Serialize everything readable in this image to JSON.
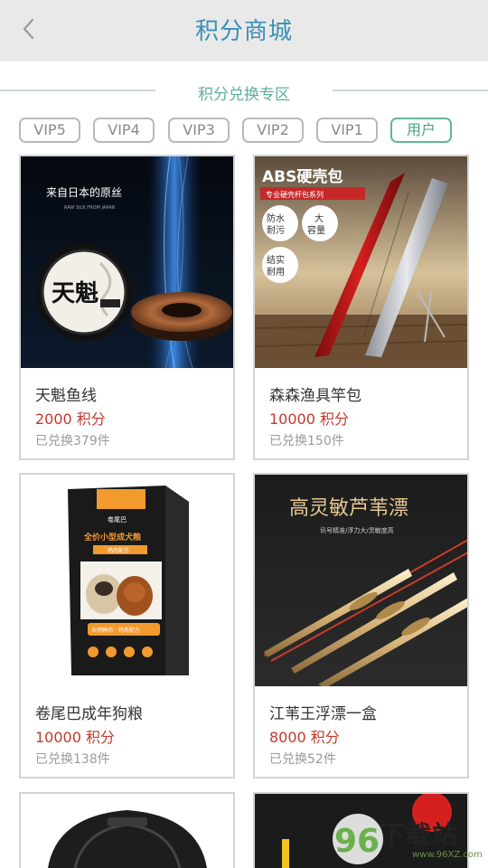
{
  "header": {
    "title": "积分商城",
    "back_icon": "chevron-left-icon"
  },
  "section": {
    "title": "积分兑换专区"
  },
  "tabs": [
    {
      "label": "VIP5",
      "active": false
    },
    {
      "label": "VIP4",
      "active": false
    },
    {
      "label": "VIP3",
      "active": false
    },
    {
      "label": "VIP2",
      "active": false
    },
    {
      "label": "VIP1",
      "active": false
    },
    {
      "label": "用户",
      "active": true
    }
  ],
  "products": [
    {
      "name": "天魁鱼线",
      "price": "2000 积分",
      "sold": "已兑换379件",
      "image": {
        "headline": "来自日本的原丝",
        "subline": "RAW SILK FROM JAPAN",
        "spool_label": "天魁"
      }
    },
    {
      "name": "森森渔具竿包",
      "price": "10000 积分",
      "sold": "已兑换150件",
      "image": {
        "headline": "ABS硬壳包",
        "banner": "专业硬壳杆包系列",
        "badges": [
          "防水耐污",
          "大容量",
          "结实耐用"
        ]
      }
    },
    {
      "name": "卷尾巴成年狗粮",
      "price": "10000 积分",
      "sold": "已兑换138件",
      "image": {
        "bag_title": "全价小型成犬粮",
        "bag_sub": "鸡肉配方",
        "bag_flavor": "天然鲜肉 · 鸡肉配方"
      }
    },
    {
      "name": "江苇王浮漂一盒",
      "price": "8000 积分",
      "sold": "已兑换52件",
      "image": {
        "headline": "高灵敏芦苇漂",
        "subline": "讯号精准/浮力大/灵敏度高"
      }
    }
  ],
  "watermark": {
    "text": "下载站",
    "digits": "96",
    "url": "www.96XZ.com"
  },
  "colors": {
    "accent": "#3a8fb7",
    "price": "#c0392b",
    "tab_active": "#62b59b"
  }
}
